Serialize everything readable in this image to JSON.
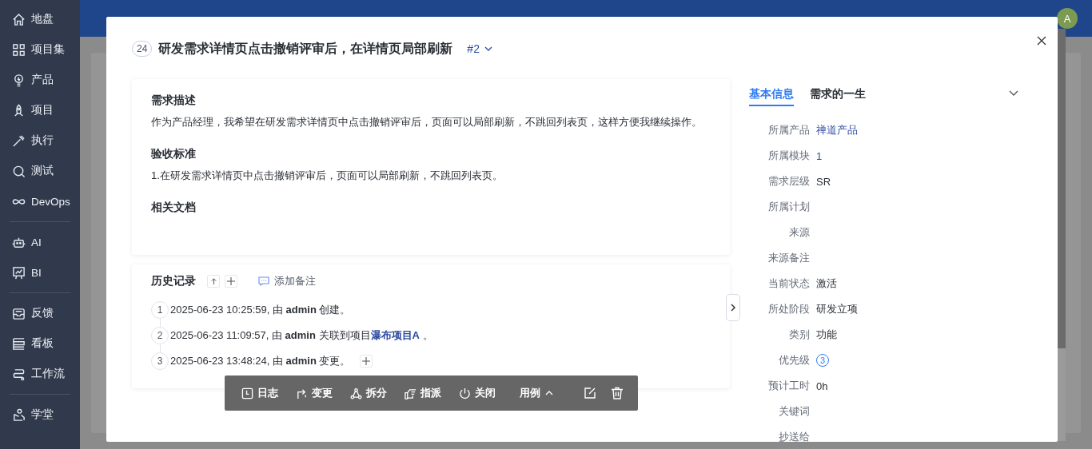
{
  "sidebar": {
    "groups": [
      [
        {
          "label": "地盘"
        },
        {
          "label": "项目集"
        },
        {
          "label": "产品"
        },
        {
          "label": "项目"
        },
        {
          "label": "执行"
        },
        {
          "label": "测试"
        },
        {
          "label": "DevOps"
        }
      ],
      [
        {
          "label": "AI"
        },
        {
          "label": "BI"
        }
      ],
      [
        {
          "label": "反馈"
        },
        {
          "label": "看板"
        },
        {
          "label": "工作流"
        }
      ],
      [
        {
          "label": "学堂"
        }
      ]
    ]
  },
  "header": {
    "avatar": "A"
  },
  "modal": {
    "id": "24",
    "title": "研发需求详情页点击撤销评审后，在详情页局部刷新",
    "version": "#2",
    "sections": [
      {
        "heading": "需求描述",
        "text": "作为产品经理，我希望在研发需求详情页中点击撤销评审后，页面可以局部刷新，不跳回列表页，这样方便我继续操作。"
      },
      {
        "heading": "验收标准",
        "text": "1.在研发需求详情页中点击撤销评审后，页面可以局部刷新，不跳回列表页。"
      },
      {
        "heading": "相关文档"
      }
    ],
    "history": {
      "title": "历史记录",
      "add_note": "添加备注",
      "entries": [
        {
          "number": "1",
          "text": "2025-06-23 10:25:59, 由 **admin** 创建。",
          "expandable": false
        },
        {
          "number": "2",
          "text": "2025-06-23 11:09:57, 由 **admin** 关联到项目",
          "link": "瀑布项目A",
          "tail": "。",
          "expandable": false
        },
        {
          "number": "3",
          "text": "2025-06-23 13:48:24, 由 **admin** 变更。",
          "expandable": true
        }
      ]
    }
  },
  "toolbar": {
    "actions": [
      {
        "label": "日志"
      },
      {
        "label": "变更"
      },
      {
        "label": "拆分"
      },
      {
        "label": "指派"
      },
      {
        "label": "关闭"
      }
    ],
    "menu": {
      "label": "用例"
    }
  },
  "tabs": [
    {
      "label": "基本信息",
      "selected": true
    },
    {
      "label": "需求的一生",
      "selected": false
    }
  ],
  "fields": [
    {
      "label": "所属产品",
      "value": "禅道产品",
      "kind": "link"
    },
    {
      "label": "所属模块",
      "value": "1",
      "kind": "link"
    },
    {
      "label": "需求层级",
      "value": "SR",
      "kind": "text"
    },
    {
      "label": "所属计划"
    },
    {
      "label": "来源"
    },
    {
      "label": "来源备注"
    },
    {
      "label": "当前状态",
      "value": "激活",
      "kind": "text"
    },
    {
      "label": "所处阶段",
      "value": "研发立项",
      "kind": "text"
    },
    {
      "label": "类别",
      "value": "功能",
      "kind": "text"
    },
    {
      "label": "优先级",
      "value": "3",
      "kind": "priority"
    },
    {
      "label": "预计工时",
      "value": "0h",
      "kind": "text"
    },
    {
      "label": "关键词"
    },
    {
      "label": "抄送给"
    }
  ]
}
